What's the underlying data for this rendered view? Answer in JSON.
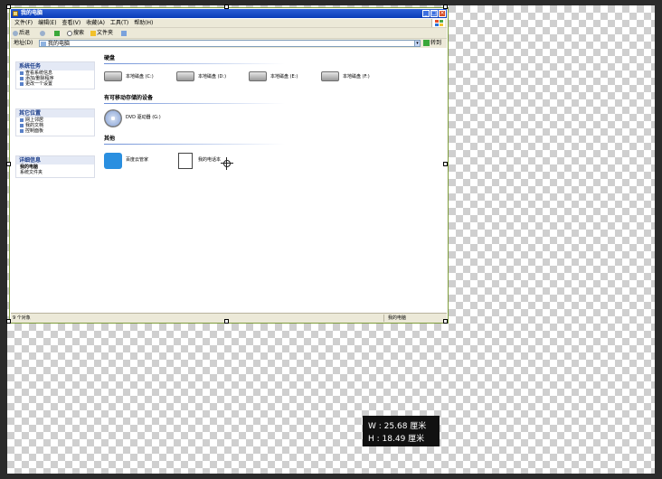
{
  "window": {
    "title": "我的电脑",
    "buttons": [
      "_",
      "□",
      "×"
    ]
  },
  "menu": [
    "文件(F)",
    "编辑(E)",
    "查看(V)",
    "收藏(A)",
    "工具(T)",
    "帮助(H)"
  ],
  "toolbar": {
    "back": "后退",
    "search": "搜索",
    "folders": "文件夹"
  },
  "address": {
    "label": "地址(D)",
    "value": "我的电脑",
    "go": "转到"
  },
  "left_panels": [
    {
      "title": "系统任务",
      "items": [
        "查看系统信息",
        "添加/删除程序",
        "更改一个设置"
      ]
    },
    {
      "title": "其它位置",
      "items": [
        "网上邻居",
        "我的文档",
        "控制面板"
      ]
    },
    {
      "title": "详细信息",
      "items": [
        "我的电脑",
        "系统文件夹"
      ]
    }
  ],
  "groups": {
    "disks": {
      "header": "硬盘",
      "items": [
        "本地磁盘 (C:)",
        "本地磁盘 (D:)",
        "本地磁盘 (E:)",
        "本地磁盘 (F:)"
      ]
    },
    "removable": {
      "header": "有可移动存储的设备",
      "items": [
        "DVD 驱动器 (G:)"
      ]
    },
    "other": {
      "header": "其他",
      "items": [
        "百度云管家",
        "我的电话本"
      ]
    }
  },
  "status": {
    "left": "9 个对象",
    "right": "我的电脑"
  },
  "dimensions": {
    "w_label": "W :",
    "w_value": "25.68 厘米",
    "h_label": "H :",
    "h_value": "18.49 厘米"
  },
  "colors": {
    "title_bar": "#0a3cb8",
    "layer_border": "#7e9c3a",
    "tooltip_bg": "#111111"
  }
}
